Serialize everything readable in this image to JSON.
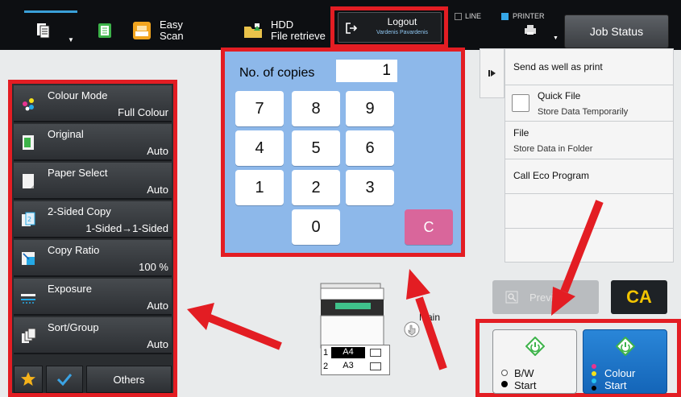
{
  "topbar": {
    "easy_scan_line1": "Easy",
    "easy_scan_line2": "Scan",
    "hdd_line1": "HDD",
    "hdd_line2": "File retrieve",
    "logout_label": "Logout",
    "logout_user": "Vardenis Pavardenis",
    "line_label": "LINE",
    "printer_label": "PRINTER",
    "job_status": "Job Status"
  },
  "functions": [
    {
      "label": "Colour Mode",
      "value": "Full Colour",
      "icon": "colour-mode-icon"
    },
    {
      "label": "Original",
      "value": "Auto",
      "icon": "original-icon"
    },
    {
      "label": "Paper Select",
      "value": "Auto",
      "icon": "paper-select-icon"
    },
    {
      "label": "2-Sided Copy",
      "value": "1-Sided→1-Sided",
      "icon": "duplex-icon"
    },
    {
      "label": "Copy Ratio",
      "value": "100 %",
      "icon": "copy-ratio-icon"
    },
    {
      "label": "Exposure",
      "value": "Auto",
      "icon": "exposure-icon"
    },
    {
      "label": "Sort/Group",
      "value": "Auto",
      "icon": "sort-group-icon"
    }
  ],
  "left_bottom": {
    "others_label": "Others"
  },
  "keypad": {
    "copies_label": "No. of copies",
    "copies_value": "1",
    "keys": [
      "7",
      "8",
      "9",
      "4",
      "5",
      "6",
      "1",
      "2",
      "3",
      "0"
    ],
    "clear_label": "C"
  },
  "right_panel": {
    "send_print": "Send as well as print",
    "quick_file_title": "Quick File",
    "quick_file_sub": "Store Data Temporarily",
    "file_title": "File",
    "file_sub": "Store Data in Folder",
    "eco": "Call Eco Program"
  },
  "preview_label": "Preview",
  "ca_label": "CA",
  "start": {
    "bw_line1": "B/W",
    "bw_line2": "Start",
    "colour_line1": "Colour",
    "colour_line2": "Start"
  },
  "machine": {
    "main_label": "Main",
    "tray1_num": "1",
    "tray1_size": "A4",
    "tray2_num": "2",
    "tray2_size": "A3"
  },
  "colors": {
    "highlight": "#e31d23",
    "keypad_bg": "#8db8ea",
    "accent_blue": "#1b74c8",
    "ca_yellow": "#f2c400"
  }
}
